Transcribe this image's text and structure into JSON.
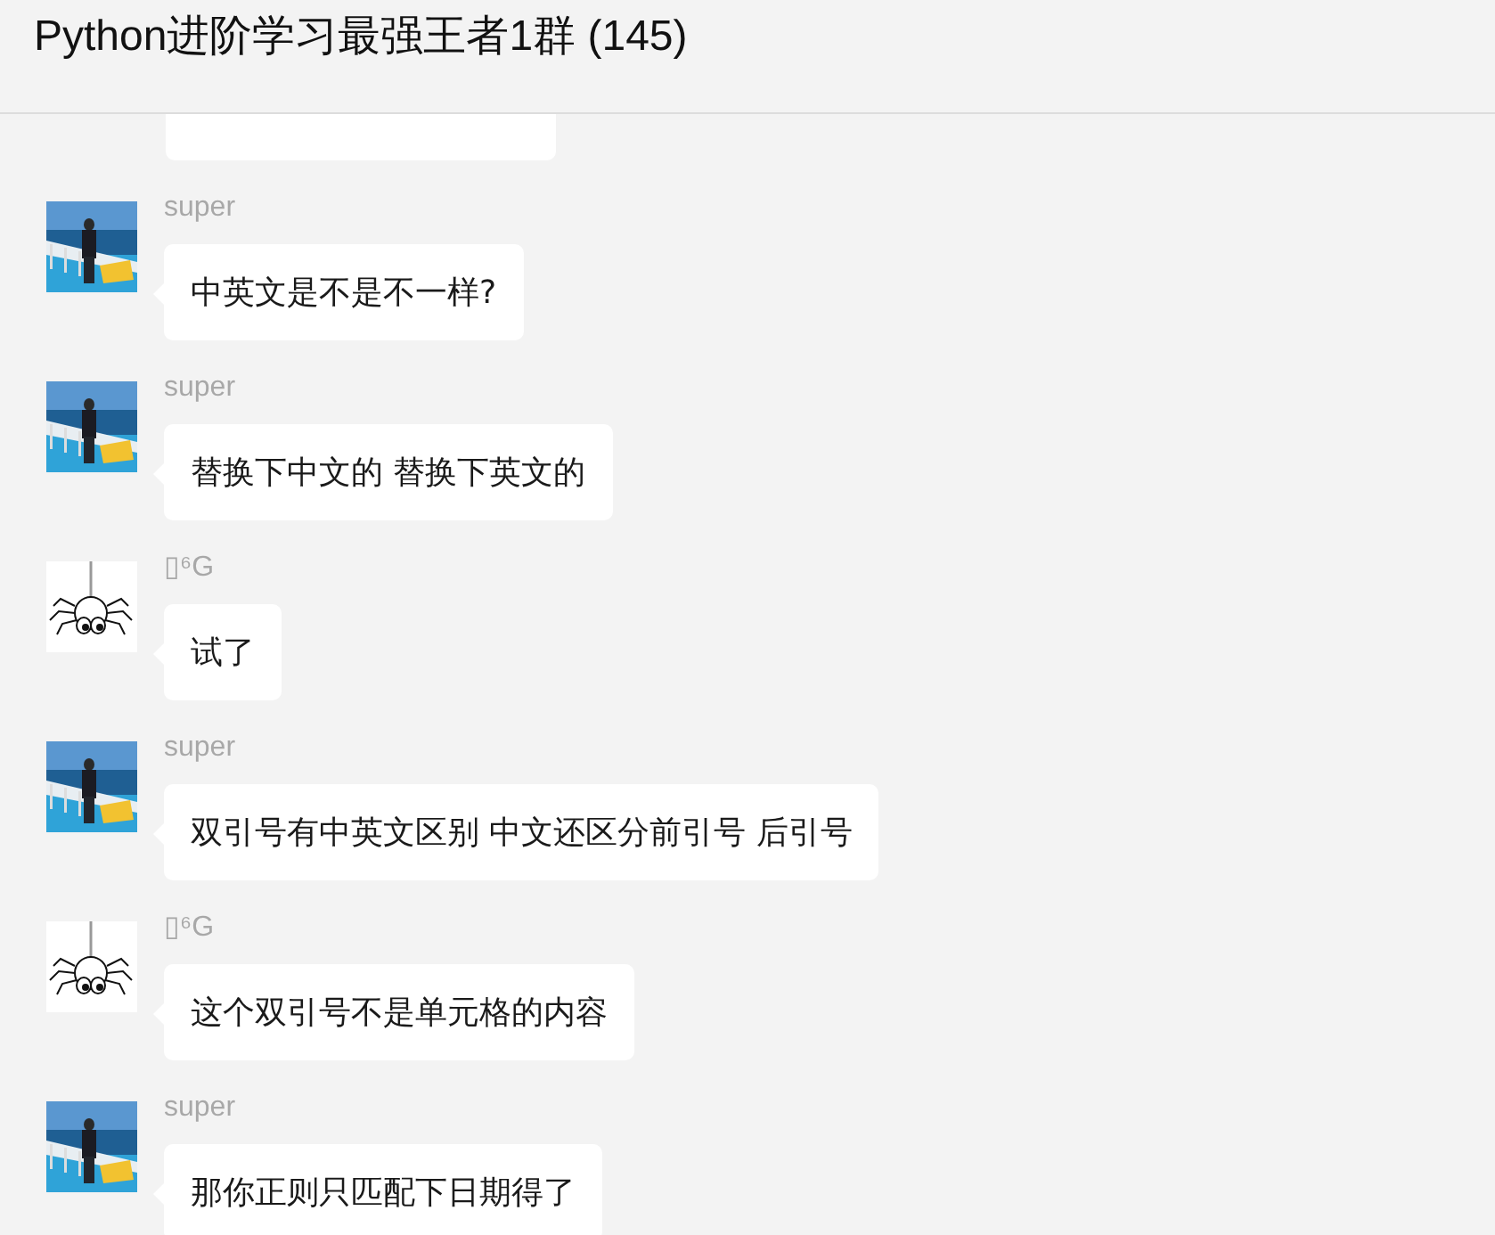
{
  "window": {
    "title": "Python进阶学习最强王者1群 (145)"
  },
  "messages": [
    {
      "sender": "super",
      "text": "中英文是不是不一样?"
    },
    {
      "sender": "super",
      "text": "替换下中文的 替换下英文的"
    },
    {
      "sender": "▯⁶G",
      "avatar": {
        "kind": "spider"
      },
      "text": "试了"
    },
    {
      "sender": "super",
      "text": "双引号有中英文区别  中文还区分前引号 后引号"
    },
    {
      "sender": "▯⁶G",
      "avatar": {
        "kind": "spider"
      },
      "text": "这个双引号不是单元格的内容"
    },
    {
      "sender": "super",
      "text": "那你正则只匹配下日期得了"
    }
  ]
}
